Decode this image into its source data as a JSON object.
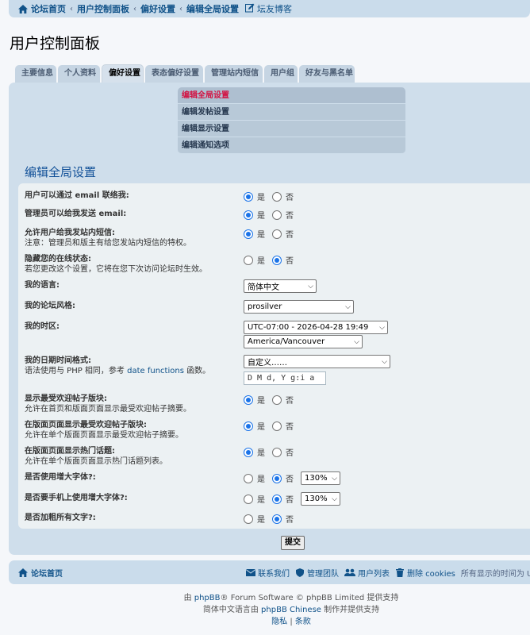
{
  "breadcrumb": {
    "items": [
      "论坛首页",
      "用户控制面板",
      "偏好设置",
      "编辑全局设置"
    ],
    "extra_link": "坛友博客"
  },
  "page_title": "用户控制面板",
  "tabs": [
    "主要信息",
    "个人资料",
    "偏好设置",
    "表态偏好设置",
    "管理站内短信",
    "用户组",
    "好友与黑名单"
  ],
  "active_tab": "偏好设置",
  "submenu": [
    "编辑全局设置",
    "编辑发帖设置",
    "编辑显示设置",
    "编辑通知选项"
  ],
  "section_title": "编辑全局设置",
  "radio_labels": {
    "yes": "是",
    "no": "否"
  },
  "fields": {
    "email": {
      "label": "用户可以通过 email 联络我:",
      "value": "是"
    },
    "admin_email": {
      "label": "管理员可以给我发送 email:",
      "value": "是"
    },
    "pm": {
      "label": "允许用户给我发站内短信:",
      "explain": "注意：管理员和版主有给您发站内短信的特权。",
      "value": "是"
    },
    "hide_online": {
      "label": "隐藏您的在线状态:",
      "explain": "若您更改这个设置，它将在您下次访问论坛时生效。",
      "value": "否"
    },
    "language": {
      "label": "我的语言:",
      "selected": "简体中文"
    },
    "style": {
      "label": "我的论坛风格:",
      "selected": "prosilver"
    },
    "timezone": {
      "label": "我的时区:",
      "selected_offset": "UTC-07:00 - 2026-04-28 19:49",
      "selected_zone": "America/Vancouver"
    },
    "dateformat": {
      "label": "我的日期时间格式:",
      "explain_prefix": "语法使用与 PHP 相同，参考 ",
      "explain_link": "date functions",
      "explain_suffix": " 函数。",
      "selected": "自定义……",
      "value": "D M d, Y g:i a"
    },
    "popular_index": {
      "label": "显示最受欢迎帖子版块:",
      "explain": "允许在首页和版面页面显示最受欢迎帖子摘要。",
      "value": "是"
    },
    "popular_forum": {
      "label": "在版面页面显示最受欢迎帖子版块:",
      "explain": "允许在单个版面页面显示最受欢迎帖子摘要。",
      "value": "是"
    },
    "hot_topics": {
      "label": "在版面页面显示热门话题:",
      "explain": "允许在单个版面页面显示热门话题列表。",
      "value": "是"
    },
    "large_font": {
      "label": "是否使用增大字体?:",
      "value": "否",
      "size": "130%"
    },
    "mobile_large_font": {
      "label": "是否要手机上使用增大字体?:",
      "value": "否",
      "size": "130%"
    },
    "bold_text": {
      "label": "是否加粗所有文字?:",
      "value": "否"
    }
  },
  "submit_label": "提交",
  "footer_nav": {
    "home": "论坛首页",
    "contact": "联系我们",
    "team": "管理团队",
    "members": "用户列表",
    "delete_cookies": "删除 cookies",
    "timezone_note": "所有显示的时间为 U"
  },
  "credits": {
    "line1_prefix": "由 ",
    "line1_link": "phpBB",
    "line1_suffix": "® Forum Software © phpBB Limited 提供支持",
    "line2_prefix": "简体中文语言由 ",
    "line2_link": "phpBB Chinese",
    "line2_suffix": " 制作并提供支持",
    "privacy": "隐私",
    "separator": "|",
    "terms": "条款"
  },
  "colors": {
    "accent": "#105289",
    "active_menu": "#d31141",
    "panel": "#cfdeeb",
    "form_bg": "#ecf1f3"
  }
}
